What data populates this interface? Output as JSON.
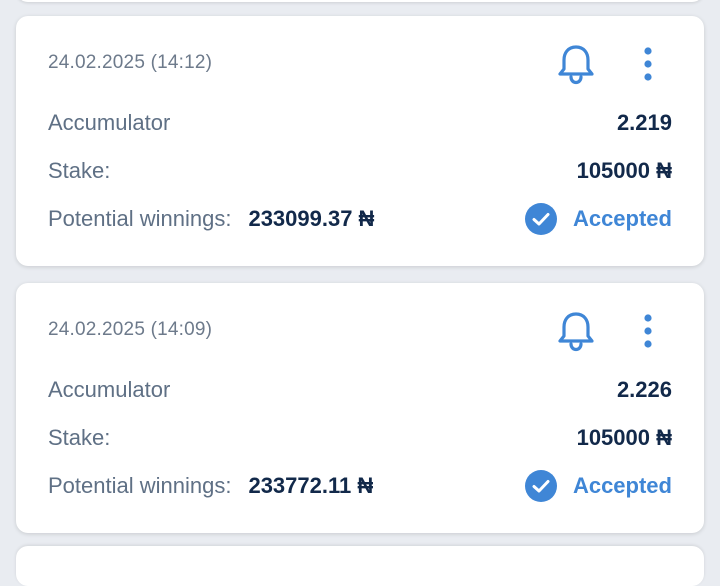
{
  "colors": {
    "accent": "#3f86d6",
    "label": "#5f7085",
    "value": "#12294a",
    "background": "#e9ecf1",
    "card": "#ffffff"
  },
  "bets": [
    {
      "date": "24.02.2025 (14:12)",
      "type": "Accumulator",
      "odds": "2.219",
      "stake_label": "Stake:",
      "stake": "105000 ₦",
      "winnings_label": "Potential winnings:",
      "winnings": "233099.37 ₦",
      "status": "Accepted",
      "icons": [
        "bell-icon",
        "more-vertical-icon",
        "check-circle-icon"
      ]
    },
    {
      "date": "24.02.2025 (14:09)",
      "type": "Accumulator",
      "odds": "2.226",
      "stake_label": "Stake:",
      "stake": "105000 ₦",
      "winnings_label": "Potential winnings:",
      "winnings": "233772.11 ₦",
      "status": "Accepted",
      "icons": [
        "bell-icon",
        "more-vertical-icon",
        "check-circle-icon"
      ]
    }
  ]
}
